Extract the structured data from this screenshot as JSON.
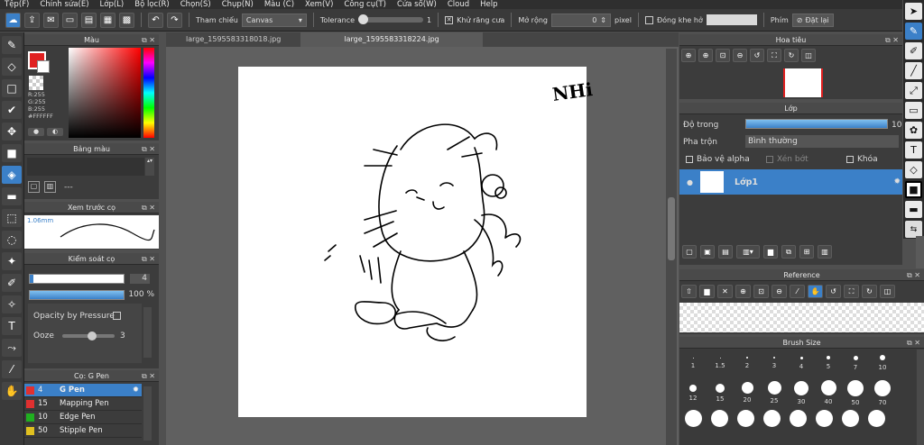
{
  "menu": [
    "Tệp(F)",
    "Chỉnh sửa(E)",
    "Lớp(L)",
    "Bộ lọc(R)",
    "Chọn(S)",
    "Chụp(N)",
    "Màu (C)",
    "Xem(V)",
    "Công cụ(T)",
    "Cửa sổ(W)",
    "Cloud",
    "Help"
  ],
  "toolbar": {
    "reference_label": "Tham chiếu",
    "reference_value": "Canvas",
    "tolerance_label": "Tolerance",
    "tolerance_value": "1",
    "antialias_label": "Khử răng cưa",
    "expand_label": "Mở rộng",
    "expand_value": "0",
    "expand_unit": "pixel",
    "close_gap_label": "Đóng khe hở",
    "shortcut_label": "Phím",
    "reset_label": "Đặt lại"
  },
  "color_panel": {
    "title": "Màu",
    "r": "R:255",
    "g": "G:255",
    "b": "B:255",
    "hex": "#FFFFFF"
  },
  "palette_panel": {
    "title": "Bảng màu",
    "value": "---"
  },
  "brush_preview": {
    "title": "Xem trước cọ",
    "size": "1.06mm"
  },
  "brush_control": {
    "title": "Kiểm soát cọ",
    "size_value": "4",
    "opacity_value": "100 %",
    "opacity_pressure_label": "Opacity by Pressure",
    "ooze_label": "Ooze",
    "ooze_value": "3"
  },
  "brush_list": {
    "title": "Cọ: G Pen",
    "items": [
      {
        "size": "4",
        "name": "G Pen",
        "color": "#e03030"
      },
      {
        "size": "15",
        "name": "Mapping Pen",
        "color": "#e03030"
      },
      {
        "size": "10",
        "name": "Edge Pen",
        "color": "#20b020"
      },
      {
        "size": "50",
        "name": "Stipple Pen",
        "color": "#e0c020"
      }
    ]
  },
  "tabs": [
    "large_1595583318018.jpg",
    "large_1595583318224.jpg"
  ],
  "canvas_text": "NHi",
  "navigator": {
    "title": "Hoa tiêu"
  },
  "layer_panel": {
    "title": "Lớp",
    "opacity_label": "Độ trong",
    "opacity_value": "10",
    "blend_label": "Pha trộn",
    "blend_value": "Bình thường",
    "protect_alpha": "Bảo vệ alpha",
    "clipping": "Xén bớt",
    "lock": "Khóa",
    "layer_name": "Lớp1"
  },
  "reference_panel": {
    "title": "Reference"
  },
  "brush_size_panel": {
    "title": "Brush Size",
    "row1": [
      "1",
      "1.5",
      "2",
      "3",
      "4",
      "5",
      "7",
      "10"
    ],
    "row2": [
      "12",
      "15",
      "20",
      "25",
      "30",
      "40",
      "50",
      "70"
    ]
  }
}
